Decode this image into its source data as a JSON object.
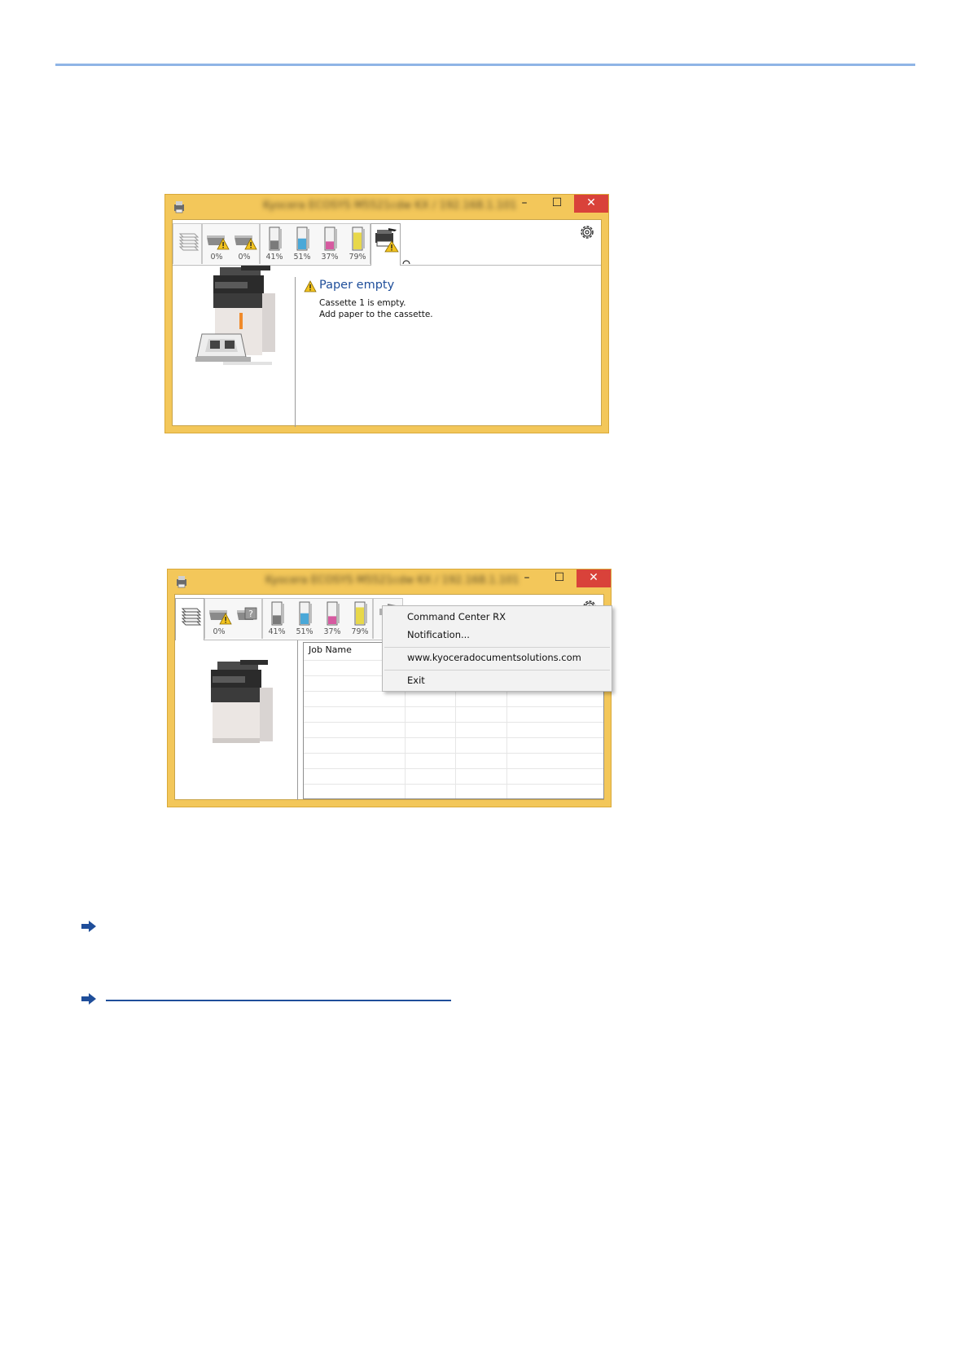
{
  "window1": {
    "title": "Kyocera ECOSYS M5521cdw  KX  /  192.168.1.101",
    "minimize": "–",
    "maximize": "☐",
    "close": "✕",
    "tray_levels": [
      "0%",
      "0%"
    ],
    "toner_levels": [
      {
        "label": "41%",
        "level": 0.41,
        "color": "#7a7a7a"
      },
      {
        "label": "51%",
        "level": 0.51,
        "color": "#4aa8d8"
      },
      {
        "label": "37%",
        "level": 0.37,
        "color": "#d65aa0"
      },
      {
        "label": "79%",
        "level": 0.79,
        "color": "#e8d84a"
      }
    ],
    "status_title": "Paper empty",
    "status_lines": [
      "Cassette 1 is empty.",
      "Add paper to the cassette."
    ]
  },
  "window2": {
    "title": "Kyocera ECOSYS M5521cdw  KX  /  192.168.1.101",
    "minimize": "–",
    "maximize": "☐",
    "close": "✕",
    "tray_levels": [
      "0%"
    ],
    "toner_levels": [
      {
        "label": "41%",
        "level": 0.41,
        "color": "#7a7a7a"
      },
      {
        "label": "51%",
        "level": 0.51,
        "color": "#4aa8d8"
      },
      {
        "label": "37%",
        "level": 0.37,
        "color": "#d65aa0"
      },
      {
        "label": "79%",
        "level": 0.79,
        "color": "#e8d84a"
      }
    ],
    "job_column": "Job Name",
    "context_menu": {
      "item1": "Command Center RX",
      "item2": "Notification...",
      "item3": "www.kyoceradocumentsolutions.com",
      "item4": "Exit"
    }
  },
  "colors": {
    "frame": "#f3c75a",
    "link": "#1f4e9a",
    "close_button": "#d9423a"
  }
}
